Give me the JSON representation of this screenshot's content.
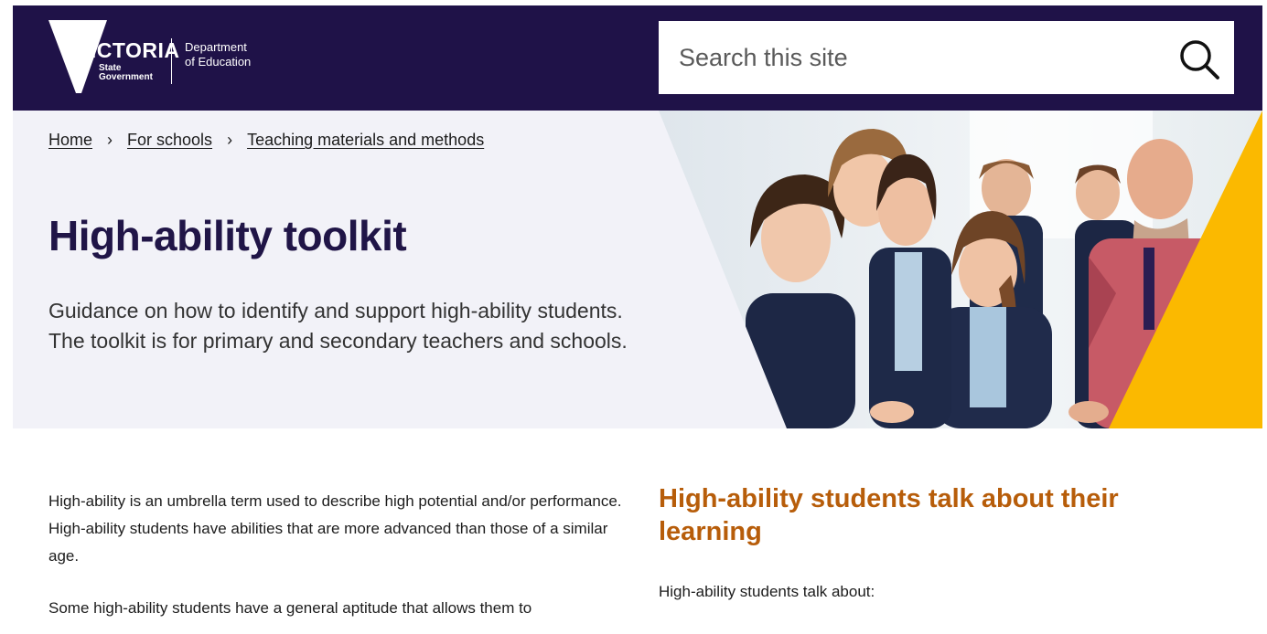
{
  "header": {
    "logo": {
      "wordmark": "VICTORIA",
      "state_line1": "State",
      "state_line2": "Government",
      "dept_line1": "Department",
      "dept_line2": "of Education"
    },
    "search": {
      "placeholder": "Search this site",
      "icon": "search-icon"
    }
  },
  "breadcrumb": [
    {
      "label": "Home"
    },
    {
      "label": "For schools"
    },
    {
      "label": "Teaching materials and methods"
    }
  ],
  "hero": {
    "title": "High-ability toolkit",
    "lead": "Guidance on how to identify and support high-ability students. The toolkit is for primary and secondary teachers and schools."
  },
  "main": {
    "paragraphs": [
      "High-ability is an umbrella term used to describe high potential and/or performance. High-ability students have abilities that are more advanced than those of a similar age.",
      "Some high-ability students have a general aptitude that allows them to"
    ]
  },
  "sidebar": {
    "heading": "High-ability students talk about their learning",
    "intro": "High-ability students talk about:"
  },
  "colors": {
    "header_bg": "#1f1248",
    "title": "#201547",
    "accent_heading": "#b75d0a",
    "hero_bg": "#f2f2f8",
    "accent_yellow": "#fbb900"
  }
}
